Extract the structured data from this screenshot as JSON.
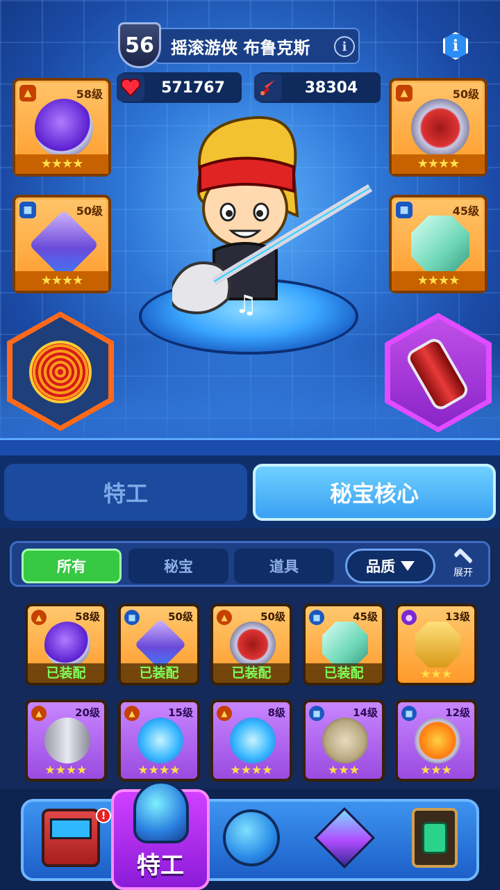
{
  "header": {
    "level": "56",
    "hero_name": "摇滚游侠 布鲁克斯",
    "info_symbol": "i",
    "hp": "571767",
    "attack": "38304",
    "hp_icon": "heart-icon",
    "attack_icon": "sword-icon"
  },
  "equipment": {
    "left_top": {
      "level": "58级",
      "stars": "★★★★",
      "rarity": "fire",
      "item": "purple-gem-bracelet"
    },
    "left_mid": {
      "level": "50级",
      "stars": "★★★★",
      "rarity": "blue",
      "item": "crystal-shard"
    },
    "right_top": {
      "level": "50级",
      "stars": "★★★★",
      "rarity": "fire",
      "item": "map-ring"
    },
    "right_mid": {
      "level": "45级",
      "stars": "★★★★",
      "rarity": "blue",
      "item": "green-octagon-gem"
    },
    "left_hex": "golden-record-disc",
    "right_hex": "red-spiked-canister"
  },
  "tabs": {
    "agent": "特工",
    "core": "秘宝核心"
  },
  "filters": {
    "all": "所有",
    "treasure": "秘宝",
    "items": "道具",
    "quality": "品质",
    "expand": "展开"
  },
  "inventory": [
    {
      "level": "58级",
      "equipped": "已装配",
      "stars": "",
      "color": "orange",
      "badge": "fire",
      "item": "purple-gem-bracelet"
    },
    {
      "level": "50级",
      "equipped": "已装配",
      "stars": "",
      "color": "orange",
      "badge": "blue",
      "item": "crystal-shard"
    },
    {
      "level": "50级",
      "equipped": "已装配",
      "stars": "",
      "color": "orange",
      "badge": "fire",
      "item": "map-ring"
    },
    {
      "level": "45级",
      "equipped": "已装配",
      "stars": "",
      "color": "orange",
      "badge": "blue",
      "item": "green-octagon-gem"
    },
    {
      "level": "13级",
      "equipped": "",
      "stars": "★★★",
      "color": "orange",
      "badge": "purple",
      "item": "golden-pyramid"
    },
    {
      "level": "20级",
      "equipped": "",
      "stars": "★★★★",
      "color": "purple",
      "badge": "fire",
      "item": "silver-canister"
    },
    {
      "level": "15级",
      "equipped": "",
      "stars": "★★★★",
      "color": "purple",
      "badge": "fire",
      "item": "blue-crystals"
    },
    {
      "level": "8级",
      "equipped": "",
      "stars": "★★★★",
      "color": "purple",
      "badge": "fire",
      "item": "blue-crystals"
    },
    {
      "level": "14级",
      "equipped": "",
      "stars": "★★★",
      "color": "purple",
      "badge": "blue",
      "item": "gas-mask"
    },
    {
      "level": "12级",
      "equipped": "",
      "stars": "★★★",
      "color": "purple",
      "badge": "blue",
      "item": "fire-orb-ring"
    }
  ],
  "nav": {
    "active_label": "特工",
    "notification": "!",
    "items": [
      "shop-console-icon",
      "agent-potion-icon",
      "planet-icon",
      "cube-icon",
      "gem-frame-icon"
    ]
  },
  "colors": {
    "orange_card": "#ff9a2a",
    "purple_card": "#9a4be0",
    "equipped_text": "#7dff5a",
    "active_filter": "#37c844"
  }
}
